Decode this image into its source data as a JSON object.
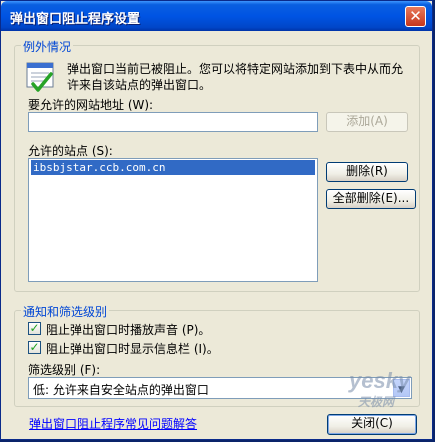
{
  "window": {
    "title": "弹出窗口阻止程序设置",
    "close_glyph": "✕"
  },
  "exceptions": {
    "legend": "例外情况",
    "description_line1": "弹出窗口当前已被阻止。您可以将特定网站添加到下表中从而允",
    "description_line2": "许来自该站点的弹出窗口。",
    "address_label": "要允许的网站地址 (W):",
    "address_value": "",
    "add_button": "添加(A)",
    "sites_label": "允许的站点 (S):",
    "sites": [
      "ibsbjstar.ccb.com.cn"
    ],
    "remove_button": "删除(R)",
    "remove_all_button": "全部删除(E)..."
  },
  "notify": {
    "legend": "通知和筛选级别",
    "play_sound_label": "阻止弹出窗口时播放声音 (P)。",
    "play_sound_checked": true,
    "show_infobar_label": "阻止弹出窗口时显示信息栏 (I)。",
    "show_infobar_checked": true,
    "filter_label": "筛选级别 (F):",
    "filter_value": "低: 允许来自安全站点的弹出窗口"
  },
  "footer": {
    "faq_link": "弹出窗口阻止程序常见问题解答",
    "close_button": "关闭(C)"
  },
  "watermark": {
    "text": "yesky",
    "subtext": "天极网"
  },
  "icons": {
    "check_mark": "✓",
    "dropdown": "▼"
  },
  "colors": {
    "title_bar": "#0054e3",
    "legend_text": "#0046d5",
    "selection": "#316ac5"
  }
}
